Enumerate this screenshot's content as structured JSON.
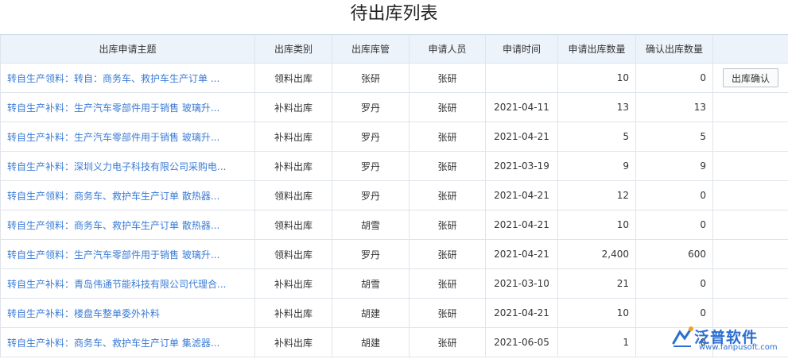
{
  "page": {
    "title": "待出库列表"
  },
  "table": {
    "headers": [
      "出库申请主题",
      "出库类别",
      "出库库管",
      "申请人员",
      "申请时间",
      "申请出库数量",
      "确认出库数量",
      ""
    ],
    "action_label": "出库确认",
    "rows": [
      {
        "subject": "转自生产领料：转自：商务车、救护车生产订单 ...",
        "type": "领料出库",
        "keeper": "张研",
        "applicant": "张研",
        "date": "",
        "requested": "10",
        "confirmed": "0",
        "action": true
      },
      {
        "subject": "转自生产补料：生产汽车零部件用于销售 玻璃升...",
        "type": "补料出库",
        "keeper": "罗丹",
        "applicant": "张研",
        "date": "2021-04-11",
        "requested": "13",
        "confirmed": "13",
        "action": false
      },
      {
        "subject": "转自生产补料：生产汽车零部件用于销售 玻璃升...",
        "type": "补料出库",
        "keeper": "罗丹",
        "applicant": "张研",
        "date": "2021-04-21",
        "requested": "5",
        "confirmed": "5",
        "action": false
      },
      {
        "subject": "转自生产补料：深圳义力电子科技有限公司采购电...",
        "type": "补料出库",
        "keeper": "罗丹",
        "applicant": "张研",
        "date": "2021-03-19",
        "requested": "9",
        "confirmed": "9",
        "action": false
      },
      {
        "subject": "转自生产领料：商务车、救护车生产订单 散热器...",
        "type": "领料出库",
        "keeper": "罗丹",
        "applicant": "张研",
        "date": "2021-04-21",
        "requested": "12",
        "confirmed": "0",
        "action": false
      },
      {
        "subject": "转自生产领料：商务车、救护车生产订单 散热器...",
        "type": "领料出库",
        "keeper": "胡雪",
        "applicant": "张研",
        "date": "2021-04-21",
        "requested": "10",
        "confirmed": "0",
        "action": false
      },
      {
        "subject": "转自生产领料：生产汽车零部件用于销售 玻璃升...",
        "type": "领料出库",
        "keeper": "罗丹",
        "applicant": "张研",
        "date": "2021-04-21",
        "requested": "2,400",
        "confirmed": "600",
        "action": false
      },
      {
        "subject": "转自生产补料：青岛伟通节能科技有限公司代理合...",
        "type": "补料出库",
        "keeper": "胡雪",
        "applicant": "张研",
        "date": "2021-03-10",
        "requested": "21",
        "confirmed": "0",
        "action": false
      },
      {
        "subject": "转自生产补料：楼盘车整单委外补料",
        "type": "补料出库",
        "keeper": "胡建",
        "applicant": "张研",
        "date": "2021-04-21",
        "requested": "10",
        "confirmed": "0",
        "action": false
      },
      {
        "subject": "转自生产补料：商务车、救护车生产订单 集滤器...",
        "type": "补料出库",
        "keeper": "胡建",
        "applicant": "张研",
        "date": "2021-06-05",
        "requested": "1",
        "confirmed": "0",
        "action": false
      }
    ]
  },
  "watermark": {
    "brand": "泛普软件",
    "url": "www.fanpusoft.com",
    "color": "#2c6fd0"
  }
}
